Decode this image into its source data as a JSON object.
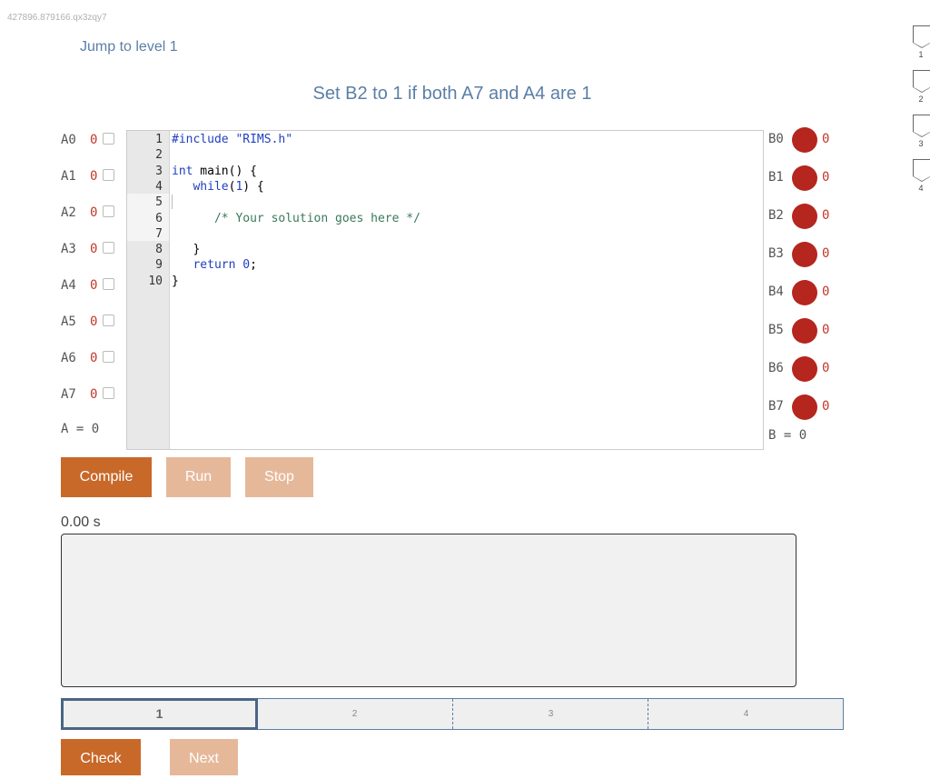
{
  "page_id": "427896.879166.qx3zqy7",
  "jump_link": "Jump to level 1",
  "title": "Set B2 to 1 if both A7 and A4 are 1",
  "inputs": [
    {
      "label": "A0",
      "value": "0"
    },
    {
      "label": "A1",
      "value": "0"
    },
    {
      "label": "A2",
      "value": "0"
    },
    {
      "label": "A3",
      "value": "0"
    },
    {
      "label": "A4",
      "value": "0"
    },
    {
      "label": "A5",
      "value": "0"
    },
    {
      "label": "A6",
      "value": "0"
    },
    {
      "label": "A7",
      "value": "0"
    }
  ],
  "a_total": "A = 0",
  "outputs": [
    {
      "label": "B0",
      "value": "0"
    },
    {
      "label": "B1",
      "value": "0"
    },
    {
      "label": "B2",
      "value": "0"
    },
    {
      "label": "B3",
      "value": "0"
    },
    {
      "label": "B4",
      "value": "0"
    },
    {
      "label": "B5",
      "value": "0"
    },
    {
      "label": "B6",
      "value": "0"
    },
    {
      "label": "B7",
      "value": "0"
    }
  ],
  "b_total": "B = 0",
  "led_color": "#b5261e",
  "editor": {
    "line_numbers": [
      "1",
      "2",
      "3",
      "4",
      "5",
      "6",
      "7",
      "8",
      "9",
      "10"
    ],
    "lines": [
      {
        "indent": "",
        "parts": [
          {
            "t": "#include \"RIMS.h\"",
            "c": "kw"
          }
        ]
      },
      {
        "indent": "",
        "parts": []
      },
      {
        "indent": "",
        "parts": [
          {
            "t": "int",
            "c": "kw"
          },
          {
            "t": " main() {",
            "c": ""
          }
        ]
      },
      {
        "indent": "   ",
        "parts": [
          {
            "t": "while",
            "c": "kw"
          },
          {
            "t": "(",
            "c": ""
          },
          {
            "t": "1",
            "c": "kw"
          },
          {
            "t": ") {",
            "c": ""
          }
        ]
      },
      {
        "indent": "",
        "parts": []
      },
      {
        "indent": "      ",
        "parts": [
          {
            "t": "/* Your solution goes here */",
            "c": "cm"
          }
        ]
      },
      {
        "indent": "",
        "parts": []
      },
      {
        "indent": "   ",
        "parts": [
          {
            "t": "}",
            "c": ""
          }
        ]
      },
      {
        "indent": "   ",
        "parts": [
          {
            "t": "return",
            "c": "kw"
          },
          {
            "t": " ",
            "c": ""
          },
          {
            "t": "0",
            "c": "kw"
          },
          {
            "t": ";",
            "c": ""
          }
        ]
      },
      {
        "indent": "",
        "parts": [
          {
            "t": "}",
            "c": ""
          }
        ]
      }
    ]
  },
  "buttons": {
    "compile": "Compile",
    "run": "Run",
    "stop": "Stop",
    "check": "Check",
    "next": "Next"
  },
  "timer": "0.00 s",
  "console_text": "",
  "progress": {
    "segments": [
      "1",
      "2",
      "3",
      "4"
    ],
    "active_index": 0
  },
  "side_levels": [
    "1",
    "2",
    "3",
    "4"
  ],
  "colors": {
    "accent": "#c8692a",
    "accent_disabled": "#e6b89a",
    "link": "#5a7fa8",
    "value_red": "#c0392b"
  }
}
